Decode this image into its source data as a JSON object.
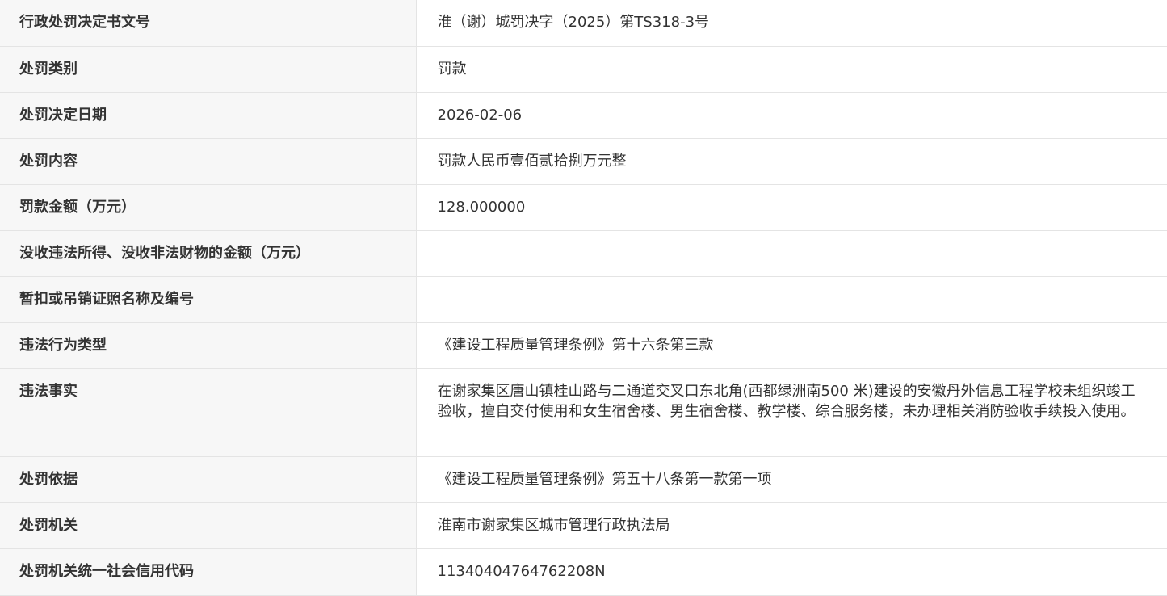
{
  "rows": [
    {
      "label": "行政处罚决定书文号",
      "value": "淮（谢）城罚决字（2025）第TS318-3号"
    },
    {
      "label": "处罚类别",
      "value": "罚款"
    },
    {
      "label": "处罚决定日期",
      "value": "2026-02-06"
    },
    {
      "label": "处罚内容",
      "value": "罚款人民币壹佰贰拾捌万元整"
    },
    {
      "label": "罚款金额（万元）",
      "value": "128.000000"
    },
    {
      "label": "没收违法所得、没收非法财物的金额（万元）",
      "value": ""
    },
    {
      "label": "暂扣或吊销证照名称及编号",
      "value": ""
    },
    {
      "label": "违法行为类型",
      "value": "《建设工程质量管理条例》第十六条第三款"
    },
    {
      "label": "违法事实",
      "value": "在谢家集区唐山镇桂山路与二通道交叉口东北角(西都绿洲南500 米)建设的安徽丹外信息工程学校未组织竣工验收，擅自交付使用和女生宿舍楼、男生宿舍楼、教学楼、综合服务楼，未办理相关消防验收手续投入使用。"
    },
    {
      "label": "处罚依据",
      "value": "《建设工程质量管理条例》第五十八条第一款第一项"
    },
    {
      "label": "处罚机关",
      "value": "淮南市谢家集区城市管理行政执法局"
    },
    {
      "label": "处罚机关统一社会信用代码",
      "value": "11340404764762208N"
    }
  ]
}
